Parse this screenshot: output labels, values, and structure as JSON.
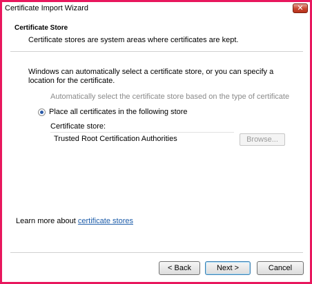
{
  "window": {
    "title": "Certificate Import Wizard",
    "close_glyph": "✕"
  },
  "header": {
    "title": "Certificate Store",
    "description": "Certificate stores are system areas where certificates are kept."
  },
  "main": {
    "intro": "Windows can automatically select a certificate store, or you can specify a location for the certificate.",
    "options": [
      {
        "label": "Automatically select the certificate store based on the type of certificate",
        "selected": false
      },
      {
        "label": "Place all certificates in the following store",
        "selected": true
      }
    ],
    "store_label": "Certificate store:",
    "store_value": "Trusted Root Certification Authorities",
    "browse_label": "Browse..."
  },
  "footer": {
    "learn_prefix": "Learn more about ",
    "learn_link": "certificate stores",
    "back_label": "< Back",
    "next_label": "Next >",
    "cancel_label": "Cancel"
  },
  "colors": {
    "frame": "#e8175d",
    "link": "#1a5aa8",
    "close": "#c7452f"
  }
}
